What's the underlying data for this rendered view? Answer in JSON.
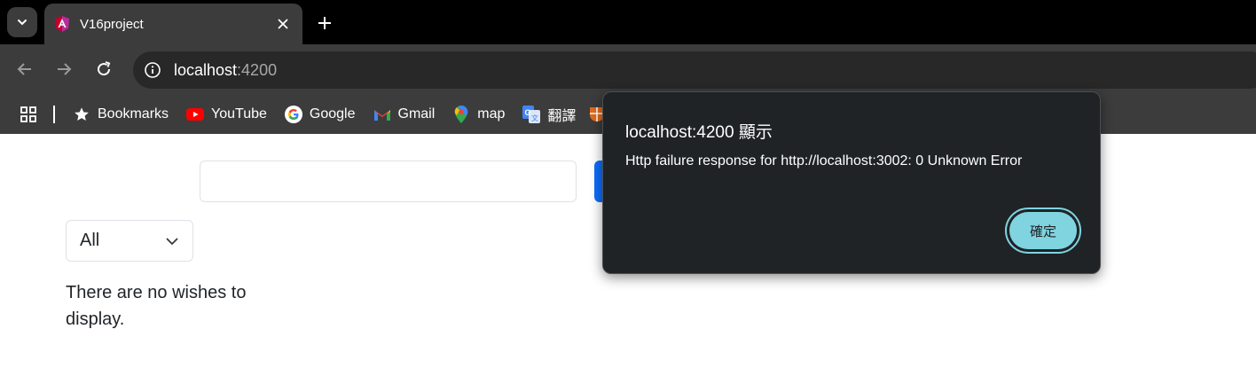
{
  "browser": {
    "tab": {
      "title": "V16project"
    },
    "address_bar": {
      "host": "localhost",
      "port": ":4200"
    },
    "bookmarks": [
      {
        "label": "Bookmarks",
        "icon": "star-icon"
      },
      {
        "label": "YouTube",
        "icon": "youtube-icon"
      },
      {
        "label": "Google",
        "icon": "google-icon"
      },
      {
        "label": "Gmail",
        "icon": "gmail-icon"
      },
      {
        "label": "map",
        "icon": "maps-icon"
      },
      {
        "label": "翻譯",
        "icon": "translate-icon"
      }
    ]
  },
  "page": {
    "search": {
      "value": "",
      "placeholder": ""
    },
    "filter": {
      "selected": "All"
    },
    "empty_message": "There are no wishes to display."
  },
  "dialog": {
    "title": "localhost:4200 顯示",
    "message": "Http failure response for http://localhost:3002: 0 Unknown Error",
    "ok_label": "確定"
  },
  "colors": {
    "accent_button": "#0d6efd",
    "dialog_bg": "#1f2326",
    "dialog_ok": "#7fd4e0"
  }
}
